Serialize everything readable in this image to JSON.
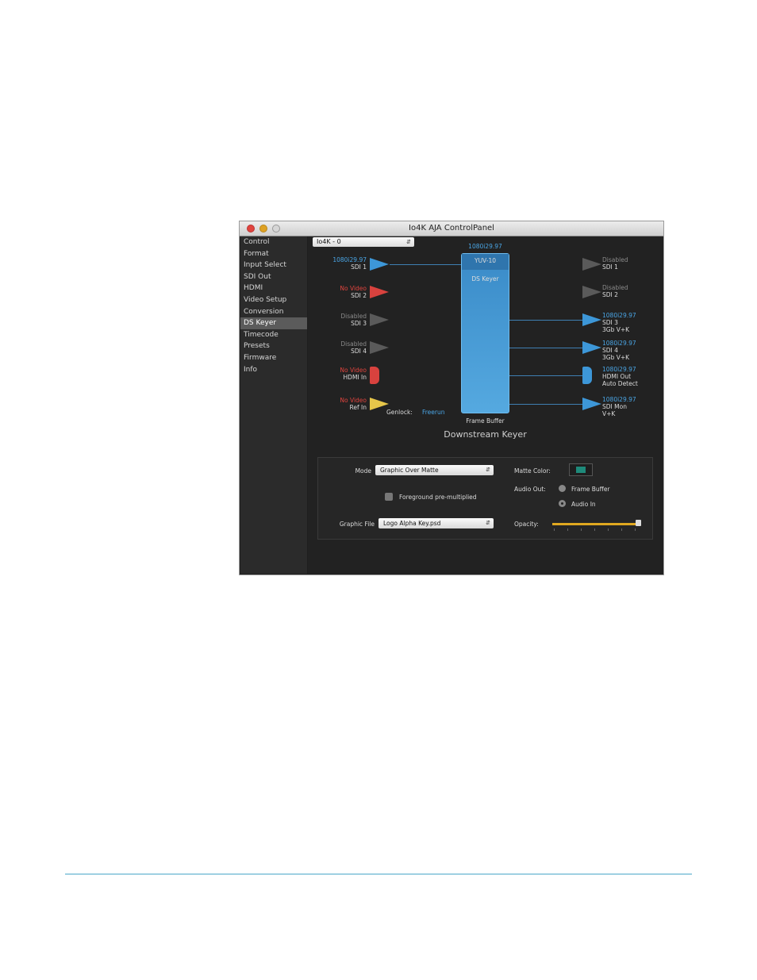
{
  "window": {
    "title": "Io4K AJA ControlPanel"
  },
  "sidebar": {
    "items": [
      {
        "label": "Control"
      },
      {
        "label": "Format"
      },
      {
        "label": "Input Select"
      },
      {
        "label": "SDI Out"
      },
      {
        "label": "HDMI"
      },
      {
        "label": "Video Setup"
      },
      {
        "label": "Conversion"
      },
      {
        "label": "DS Keyer",
        "selected": true
      },
      {
        "label": "Timecode"
      },
      {
        "label": "Presets"
      },
      {
        "label": "Firmware"
      },
      {
        "label": "Info"
      }
    ]
  },
  "device": {
    "selected": "Io4K - 0"
  },
  "inputs": [
    {
      "status": "1080i29.97",
      "name": "SDI 1"
    },
    {
      "status": "No Video",
      "name": "SDI 2"
    },
    {
      "status": "Disabled",
      "name": "SDI 3"
    },
    {
      "status": "Disabled",
      "name": "SDI 4"
    },
    {
      "status": "No Video",
      "name": "HDMI In"
    },
    {
      "status": "No Video",
      "name": "Ref In"
    }
  ],
  "genlock": {
    "label": "Genlock:",
    "value": "Freerun"
  },
  "frame_buffer": {
    "format": "1080i29.97",
    "pixel_format": "YUV-10",
    "mode": "DS Keyer",
    "label": "Frame Buffer"
  },
  "outputs": [
    {
      "status": "Disabled",
      "name": "SDI 1",
      "detail": ""
    },
    {
      "status": "Disabled",
      "name": "SDI 2",
      "detail": ""
    },
    {
      "status": "1080i29.97",
      "name": "SDI 3",
      "detail": "3Gb V+K"
    },
    {
      "status": "1080i29.97",
      "name": "SDI 4",
      "detail": "3Gb V+K"
    },
    {
      "status": "1080i29.97",
      "name": "HDMI Out",
      "detail": "Auto Detect"
    },
    {
      "status": "1080i29.97",
      "name": "SDI Mon",
      "detail": "V+K"
    }
  ],
  "section_title": "Downstream Keyer",
  "keyer": {
    "mode_label": "Mode",
    "mode_value": "Graphic Over Matte",
    "fg_premult_label": "Foreground pre-multiplied",
    "fg_premult_checked": false,
    "graphic_file_label": "Graphic File",
    "graphic_file_value": "Logo Alpha Key.psd",
    "matte_color_label": "Matte Color:",
    "matte_color": "#1e8a7a",
    "audio_out_label": "Audio Out:",
    "audio_out_options": [
      "Frame Buffer",
      "Audio In"
    ],
    "audio_out_selected": "Audio In",
    "opacity_label": "Opacity:",
    "opacity": 1.0
  },
  "colors": {
    "accent_blue": "#4aa6e6",
    "no_video_red": "#e0443e",
    "slider_gold": "#e0a820"
  }
}
